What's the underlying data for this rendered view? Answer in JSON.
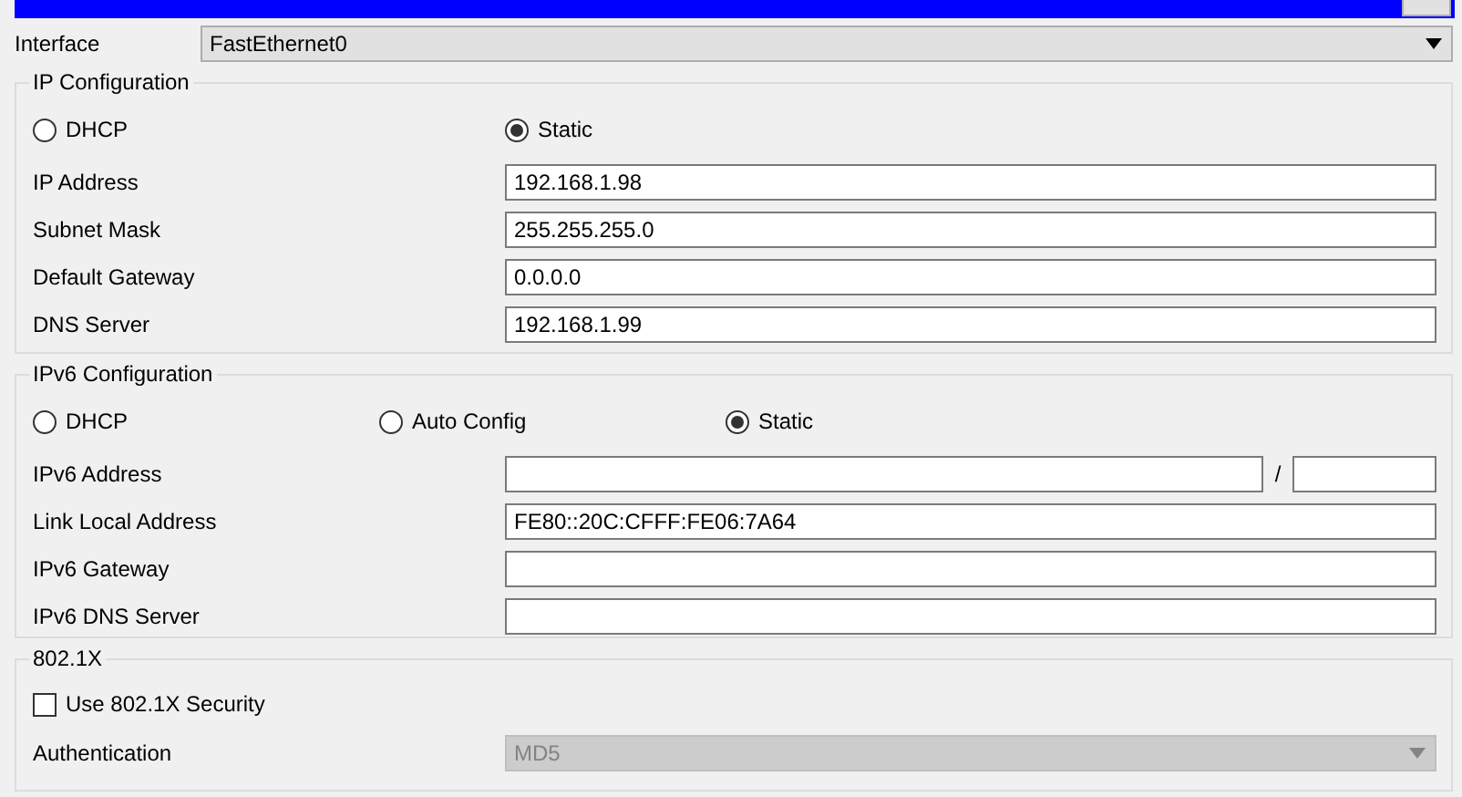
{
  "interface": {
    "label": "Interface",
    "value": "FastEthernet0"
  },
  "ip_configuration": {
    "title": "IP Configuration",
    "modes": [
      {
        "label": "DHCP",
        "selected": false
      },
      {
        "label": "Static",
        "selected": true
      }
    ],
    "fields": [
      {
        "label": "IP Address",
        "value": "192.168.1.98"
      },
      {
        "label": "Subnet Mask",
        "value": "255.255.255.0"
      },
      {
        "label": "Default Gateway",
        "value": "0.0.0.0"
      },
      {
        "label": "DNS Server",
        "value": "192.168.1.99"
      }
    ]
  },
  "ipv6_configuration": {
    "title": "IPv6 Configuration",
    "modes": [
      {
        "label": "DHCP",
        "selected": false
      },
      {
        "label": "Auto Config",
        "selected": false
      },
      {
        "label": "Static",
        "selected": true
      }
    ],
    "fields": [
      {
        "label": "IPv6 Address",
        "kind": "prefixed",
        "separator": "/"
      },
      {
        "label": "Link Local Address",
        "kind": "plain",
        "value": "FE80::20C:CFFF:FE06:7A64"
      },
      {
        "label": "IPv6 Gateway",
        "kind": "plain"
      },
      {
        "label": "IPv6 DNS Server",
        "kind": "plain"
      }
    ]
  },
  "dot1x": {
    "title": "802.1X",
    "use_security": {
      "label": "Use 802.1X Security",
      "checked": false
    },
    "authentication": {
      "label": "Authentication",
      "value": "MD5",
      "disabled": true
    }
  }
}
